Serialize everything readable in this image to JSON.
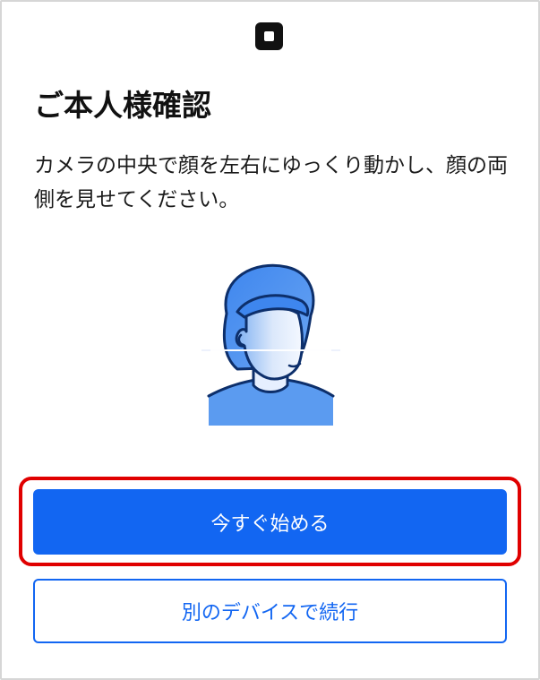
{
  "header": {
    "logo_icon": "square-logo-icon"
  },
  "main": {
    "title": "ご本人様確認",
    "description": "カメラの中央で顔を左右にゆっくり動かし、顔の両側を見せてください。",
    "illustration_icon": "face-scan-illustration"
  },
  "actions": {
    "primary_label": "今すぐ始める",
    "secondary_label": "別のデバイスで続行"
  },
  "colors": {
    "accent": "#1266f2",
    "highlight": "#e00000",
    "illustration_light": "#5b9bf0"
  }
}
